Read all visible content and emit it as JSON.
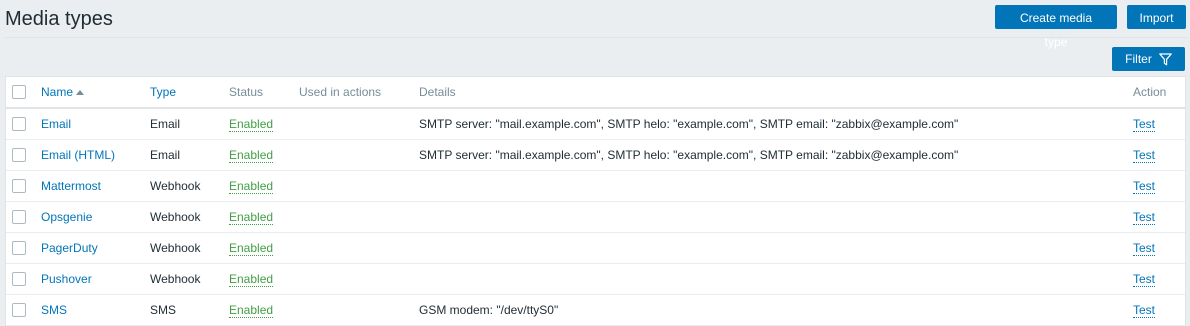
{
  "page": {
    "title": "Media types"
  },
  "toolbar": {
    "create_label": "Create media type",
    "import_label": "Import",
    "filter_label": "Filter"
  },
  "table": {
    "headers": {
      "name": "Name",
      "type": "Type",
      "status": "Status",
      "used_in_actions": "Used in actions",
      "details": "Details",
      "action": "Action"
    },
    "rows": [
      {
        "name": "Email",
        "type": "Email",
        "status": "Enabled",
        "used_in_actions": "",
        "details": "SMTP server: \"mail.example.com\", SMTP helo: \"example.com\", SMTP email: \"zabbix@example.com\"",
        "action": "Test"
      },
      {
        "name": "Email (HTML)",
        "type": "Email",
        "status": "Enabled",
        "used_in_actions": "",
        "details": "SMTP server: \"mail.example.com\", SMTP helo: \"example.com\", SMTP email: \"zabbix@example.com\"",
        "action": "Test"
      },
      {
        "name": "Mattermost",
        "type": "Webhook",
        "status": "Enabled",
        "used_in_actions": "",
        "details": "",
        "action": "Test"
      },
      {
        "name": "Opsgenie",
        "type": "Webhook",
        "status": "Enabled",
        "used_in_actions": "",
        "details": "",
        "action": "Test"
      },
      {
        "name": "PagerDuty",
        "type": "Webhook",
        "status": "Enabled",
        "used_in_actions": "",
        "details": "",
        "action": "Test"
      },
      {
        "name": "Pushover",
        "type": "Webhook",
        "status": "Enabled",
        "used_in_actions": "",
        "details": "",
        "action": "Test"
      },
      {
        "name": "SMS",
        "type": "SMS",
        "status": "Enabled",
        "used_in_actions": "",
        "details": "GSM modem: \"/dev/ttyS0\"",
        "action": "Test"
      }
    ]
  },
  "colors": {
    "accent": "#0275b8",
    "enabled": "#429e47",
    "header_text": "#768d99",
    "background": "#ebeef0"
  }
}
